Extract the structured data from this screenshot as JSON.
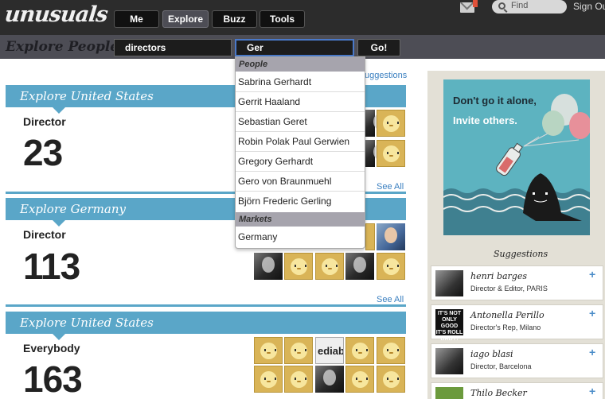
{
  "header": {
    "logo": "unusuals",
    "nav": [
      "Me",
      "Explore",
      "Buzz",
      "Tools"
    ],
    "active_nav": "Explore",
    "find_label": "Find",
    "signout_label": "Sign Out"
  },
  "search": {
    "page_title": "Explore People",
    "field1_value": "directors",
    "field2_value": "Ger",
    "go_label": "Go!"
  },
  "dropdown": {
    "people_header": "People",
    "people": [
      "Sabrina Gerhardt",
      "Gerrit Haaland",
      "Sebastian Geret",
      "Robin Polak Paul Gerwien",
      "Gregory Gerhardt",
      "Gero von Braunmuehl",
      "Björn Frederic Gerling"
    ],
    "markets_header": "Markets",
    "markets": [
      "Germany"
    ]
  },
  "main": {
    "suggestions_link": "uggestions",
    "sections": [
      {
        "title": "Explore United States",
        "label": "Director",
        "count": "23"
      },
      {
        "title": "Explore Germany",
        "label": "Director",
        "count": "113"
      },
      {
        "title": "Explore United States",
        "label": "Everybody",
        "count": "163"
      }
    ],
    "see_all": "See All",
    "tile_sign_text": "ediabe"
  },
  "sidebar": {
    "promo_line1": "Don't go it alone,",
    "promo_line2": "Invite others.",
    "suggestions_title": "Suggestions",
    "people": [
      {
        "name": "henri barges",
        "role": "Director & Editor, PARIS"
      },
      {
        "name": "Antonella Perillo",
        "role": "Director's Rep, Milano"
      },
      {
        "name": "iago blasi",
        "role": "Director, Barcelona"
      },
      {
        "name": "Thilo Becker",
        "role": ""
      }
    ],
    "thumb2_text": "IT'S NOT ONLY GOOD IT'S ROLL BABY!",
    "plus_label": "+"
  },
  "colors": {
    "topbar": "#2c2c2c",
    "subbar": "#4d4d55",
    "section_blue": "#5aa6c8",
    "link_blue": "#3a7fc0",
    "sidebar_bg": "#e3e0d6",
    "promo_teal": "#5db3c0",
    "focus_border": "#4a79c9"
  },
  "icons": [
    "mail-icon",
    "search-icon",
    "plus-icon",
    "chick-avatar-icon",
    "shark-illustration",
    "bottle-illustration",
    "balloons-illustration"
  ]
}
